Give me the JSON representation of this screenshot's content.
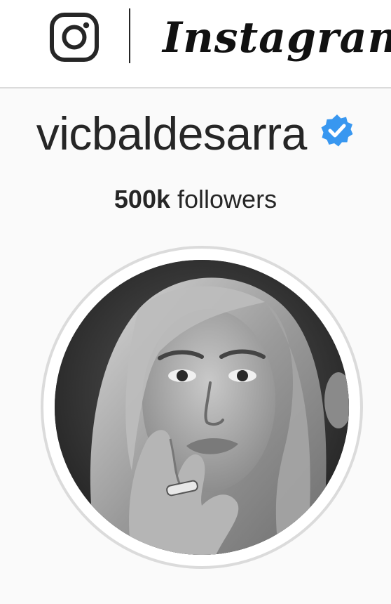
{
  "header": {
    "logo_icon": "instagram-camera-icon",
    "wordmark": "Instagram"
  },
  "profile": {
    "username": "vicbaldesarra",
    "verified_icon": "verified-badge-icon",
    "verified_color": "#3897f0",
    "followers_count": "500k",
    "followers_label": "followers",
    "avatar_alt": "profile photo"
  },
  "colors": {
    "background": "#fafafa",
    "header_background": "#ffffff",
    "border": "#dbdbdb",
    "text": "#262626"
  }
}
